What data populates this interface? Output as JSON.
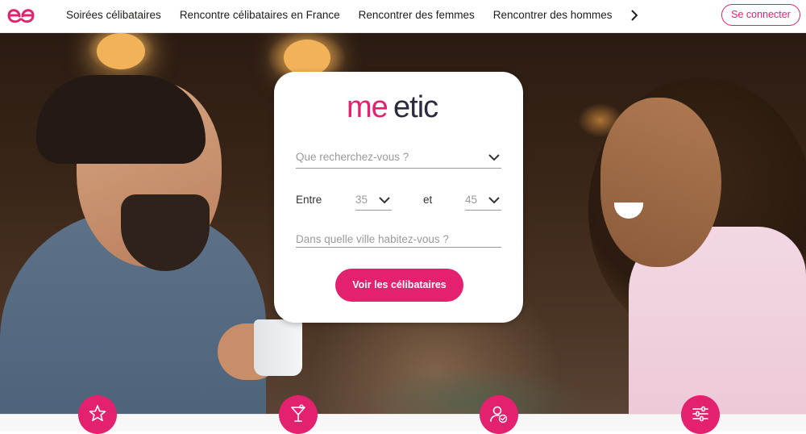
{
  "nav": {
    "items": [
      {
        "label": "Soirées célibataires"
      },
      {
        "label": "Rencontre célibataires en France"
      },
      {
        "label": "Rencontrer des femmes"
      },
      {
        "label": "Rencontrer des hommes"
      }
    ],
    "next_icon": "chevron-right-icon",
    "login_label": "Se connecter"
  },
  "brand": {
    "name": "meetic",
    "color": "#e4216e"
  },
  "search": {
    "looking_for_placeholder": "Que recherchez-vous ?",
    "age_between_label": "Entre",
    "age_min": "35",
    "age_and_label": "et",
    "age_max": "45",
    "city_placeholder": "Dans quelle ville habitez-vous ?",
    "submit_label": "Voir les célibataires"
  },
  "features": [
    {
      "icon": "star-icon"
    },
    {
      "icon": "cocktail-icon"
    },
    {
      "icon": "verified-user-icon"
    },
    {
      "icon": "sliders-icon"
    }
  ],
  "colors": {
    "accent": "#e4216e",
    "text_dark": "#1d1d1b",
    "placeholder": "#9a9a9a"
  }
}
